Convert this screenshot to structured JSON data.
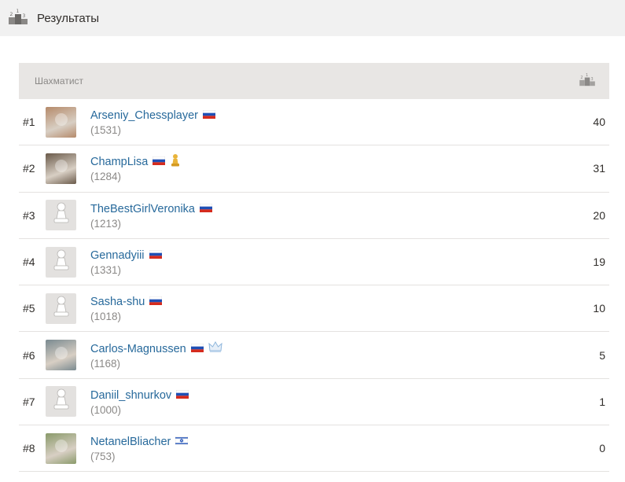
{
  "header": {
    "title": "Результаты",
    "icon": "podium-icon"
  },
  "table": {
    "player_column": "Шахматист",
    "score_column_icon": "podium-icon",
    "rows": [
      {
        "rank": "#1",
        "username": "Arseniy_Chessplayer",
        "rating": "(1531)",
        "flag": "russia-flag",
        "badge": "",
        "score": "40",
        "avatar": "photo"
      },
      {
        "rank": "#2",
        "username": "ChampLisa",
        "rating": "(1284)",
        "flag": "russia-flag",
        "badge": "gold-pawn-icon",
        "score": "31",
        "avatar": "photo"
      },
      {
        "rank": "#3",
        "username": "TheBestGirlVeronika",
        "rating": "(1213)",
        "flag": "russia-flag",
        "badge": "",
        "score": "20",
        "avatar": "pawn"
      },
      {
        "rank": "#4",
        "username": "Gennadyiii",
        "rating": "(1331)",
        "flag": "russia-flag",
        "badge": "",
        "score": "19",
        "avatar": "pawn"
      },
      {
        "rank": "#5",
        "username": "Sasha-shu",
        "rating": "(1018)",
        "flag": "russia-flag",
        "badge": "",
        "score": "10",
        "avatar": "pawn"
      },
      {
        "rank": "#6",
        "username": "Carlos-Magnussen",
        "rating": "(1168)",
        "flag": "russia-flag",
        "badge": "crown-icon",
        "score": "5",
        "avatar": "photo"
      },
      {
        "rank": "#7",
        "username": "Daniil_shnurkov",
        "rating": "(1000)",
        "flag": "russia-flag",
        "badge": "",
        "score": "1",
        "avatar": "pawn"
      },
      {
        "rank": "#8",
        "username": "NetanelBliacher",
        "rating": "(753)",
        "flag": "israel-flag",
        "badge": "",
        "score": "0",
        "avatar": "photo"
      }
    ]
  },
  "colors": {
    "link": "#27699b",
    "header_bg": "#e8e6e4",
    "topbar_bg": "#f1f1f1",
    "muted": "#8b8987"
  }
}
